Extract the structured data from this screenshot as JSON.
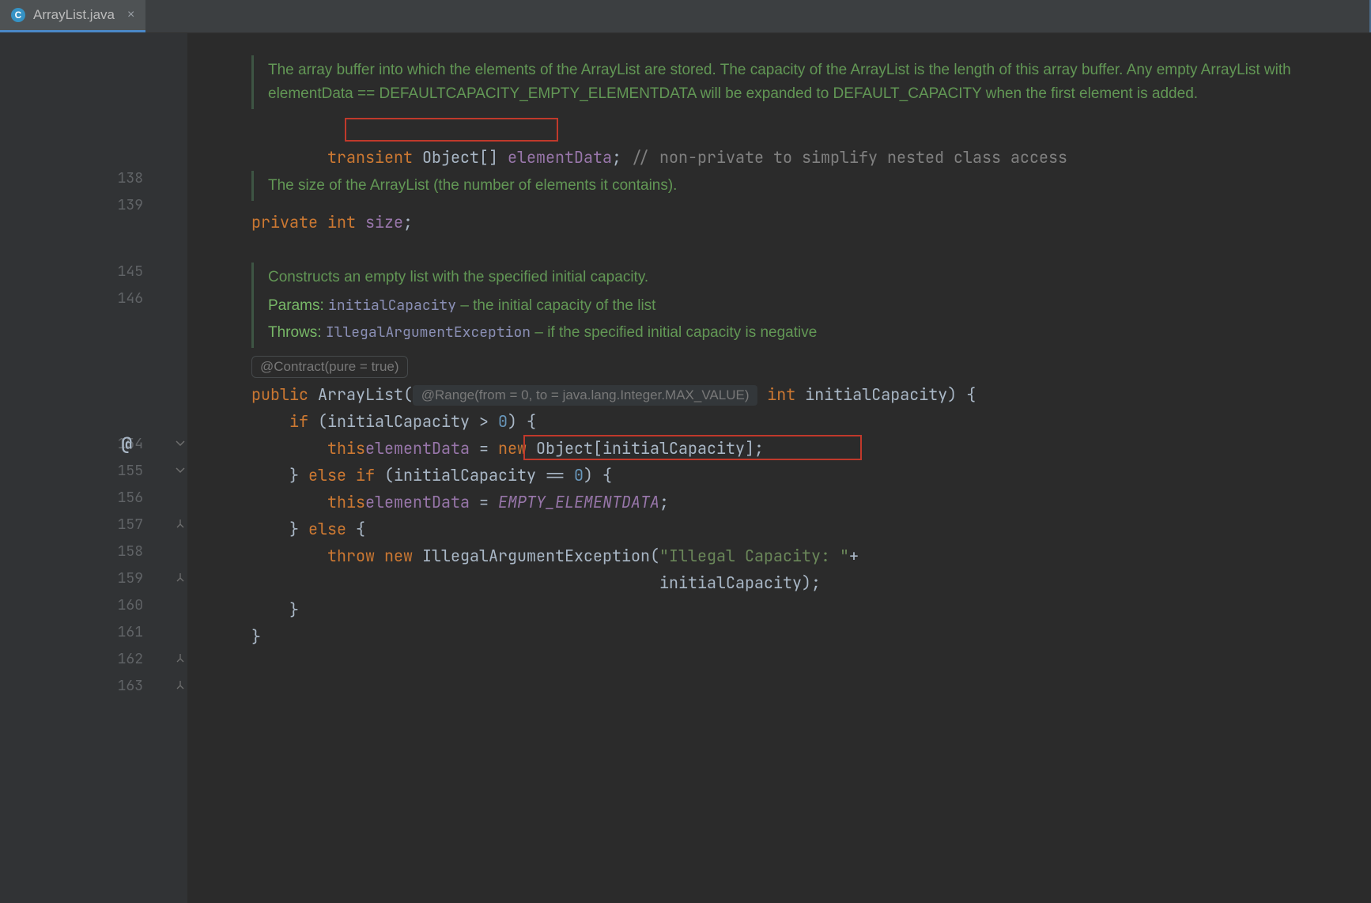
{
  "tab": {
    "filename": "ArrayList.java",
    "icon_letter": "C"
  },
  "lineNumbers": [
    "138",
    "139",
    "145",
    "146",
    "154",
    "155",
    "156",
    "157",
    "158",
    "159",
    "160",
    "161",
    "162",
    "163"
  ],
  "doc1": "The array buffer into which the elements of the ArrayList are stored. The capacity of the ArrayList is the length of this array buffer. Any empty ArrayList with elementData == DEFAULTCAPACITY_EMPTY_ELEMENTDATA will be expanded to DEFAULT_CAPACITY when the first element is added.",
  "line138": {
    "kw": "transient ",
    "decl": "Object[] ",
    "field": "elementData",
    "semi": "; ",
    "comment": "// non-private to simplify nested class access"
  },
  "doc2": "The size of the ArrayList (the number of elements it contains).",
  "line145": {
    "kw1": "private ",
    "kw2": "int ",
    "field": "size",
    "semi": ";"
  },
  "doc3": {
    "summary": "Constructs an empty list with the specified initial capacity.",
    "paramsLabel": "Params: ",
    "paramName": "initialCapacity",
    "paramDesc": " – the initial capacity of the list",
    "throwsLabel": "Throws: ",
    "excName": "IllegalArgumentException",
    "excDesc": " – if the specified initial capacity is negative"
  },
  "contractHint": "@Contract(pure = true)",
  "line154": {
    "kw": "public ",
    "name": "ArrayList",
    "open": "(",
    "annHint": " @Range(from = 0, to = java.lang.Integer.MAX_VALUE) ",
    "kw2": " int ",
    "param": "initialCapacity",
    "rest": ") {"
  },
  "line155": {
    "indent": "    ",
    "kw": "if ",
    "rest": "(initialCapacity > ",
    "zero": "0",
    "rest2": ") {"
  },
  "line156": {
    "indent": "        ",
    "kwthis": "this",
    ".": ".",
    "field": "elementData",
    "eq": " = ",
    "kwnew": "new ",
    "obj": "Object[initialCapacity]",
    "semi": ";"
  },
  "line157": {
    "indent": "    ",
    "close": "} ",
    "kw": "else if ",
    "rest": "(initialCapacity == ",
    "zero": "0",
    "rest2": ") {"
  },
  "line158": {
    "indent": "        ",
    "kwthis": "this",
    ".": ".",
    "field": "elementData",
    "eq": " = ",
    "const": "EMPTY_ELEMENTDATA",
    "semi": ";"
  },
  "line159": {
    "indent": "    ",
    "close": "} ",
    "kw": "else ",
    "open": "{"
  },
  "line160": {
    "indent": "        ",
    "kw": "throw new ",
    "exc": "IllegalArgumentException(",
    "str": "\"Illegal Capacity: \"",
    "plus": "+"
  },
  "line161": {
    "indent": "                                           ",
    "rest": "initialCapacity);"
  },
  "line162": {
    "indent": "    ",
    "close": "}"
  },
  "line163": {
    "close": "}"
  }
}
